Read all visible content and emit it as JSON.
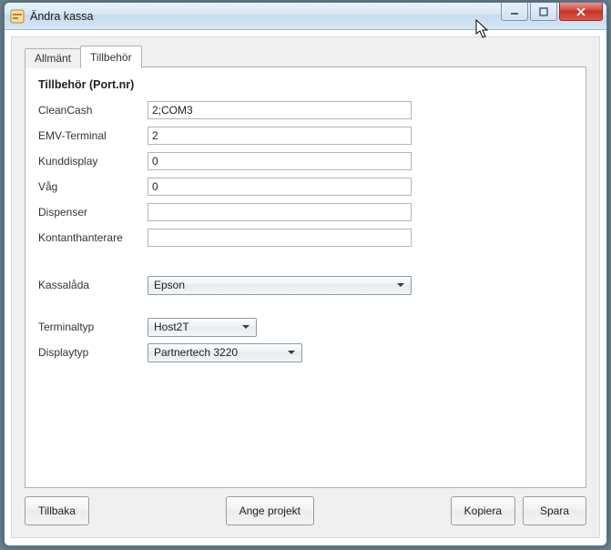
{
  "title": "Ändra kassa",
  "tabs": {
    "general": "Allmänt",
    "accessories": "Tillbehör"
  },
  "section_heading": "Tillbehör (Port.nr)",
  "fields": {
    "cleancash": {
      "label": "CleanCash",
      "value": "2;COM3"
    },
    "emv": {
      "label": "EMV-Terminal",
      "value": "2"
    },
    "kunddisplay": {
      "label": "Kunddisplay",
      "value": "0"
    },
    "vag": {
      "label": "Våg",
      "value": "0"
    },
    "dispenser": {
      "label": "Dispenser",
      "value": ""
    },
    "kontant": {
      "label": "Kontanthanterare",
      "value": ""
    }
  },
  "selects": {
    "kassalada": {
      "label": "Kassalåda",
      "value": "Epson"
    },
    "terminaltyp": {
      "label": "Terminaltyp",
      "value": "Host2T"
    },
    "displaytyp": {
      "label": "Displaytyp",
      "value": "Partnertech 3220"
    }
  },
  "buttons": {
    "tillbaka": "Tillbaka",
    "angeprojekt": "Ange projekt",
    "kopiera": "Kopiera",
    "spara": "Spara"
  }
}
